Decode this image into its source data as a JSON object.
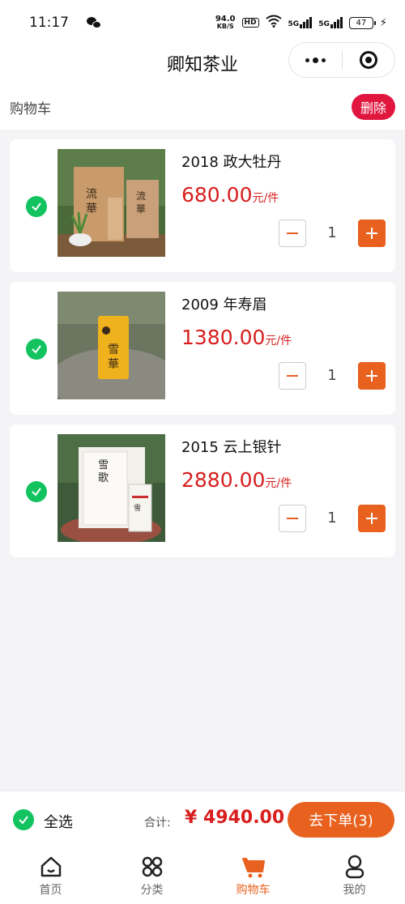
{
  "status_bar": {
    "time": "11:17",
    "net_speed": "94.0",
    "net_unit": "KB/S",
    "hd": "HD",
    "sig1": "5G",
    "sig2": "5G",
    "battery": "47"
  },
  "nav": {
    "title": "卿知茶业"
  },
  "header": {
    "label": "购物车",
    "delete_label": "删除"
  },
  "cart": {
    "unit_label": "元/件",
    "items": [
      {
        "name": "2018 政大牡丹",
        "price": "680.00",
        "qty": "1",
        "selected": true
      },
      {
        "name": "2009 年寿眉",
        "price": "1380.00",
        "qty": "1",
        "selected": true
      },
      {
        "name": "2015 云上银针",
        "price": "2880.00",
        "qty": "1",
        "selected": true
      }
    ]
  },
  "checkout": {
    "select_all_label": "全选",
    "total_label": "合计:",
    "total": "¥ 4940.00",
    "order_label": "去下单(3)"
  },
  "tabbar": {
    "items": [
      {
        "label": "首页",
        "icon": "home-icon"
      },
      {
        "label": "分类",
        "icon": "category-icon"
      },
      {
        "label": "购物车",
        "icon": "cart-icon",
        "active": true
      },
      {
        "label": "我的",
        "icon": "profile-icon"
      }
    ]
  },
  "colors": {
    "accent": "#e8611f",
    "price": "#d81e1e",
    "check": "#12c35f",
    "delete": "#e0163f"
  }
}
